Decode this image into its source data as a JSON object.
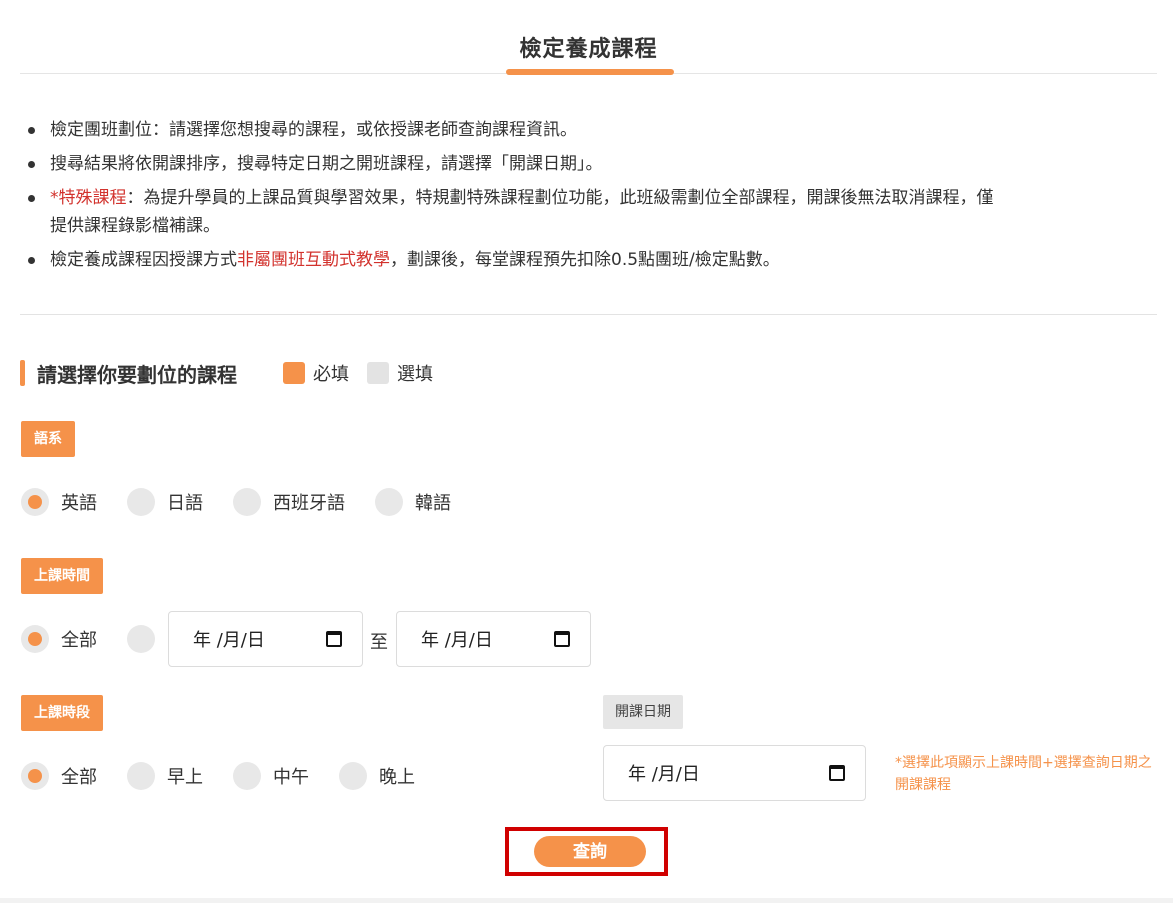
{
  "header": {
    "title": "檢定養成課程"
  },
  "notes": {
    "n1": "檢定團班劃位：請選擇您想搜尋的課程，或依授課老師查詢課程資訊。",
    "n2": "搜尋結果將依開課排序，搜尋特定日期之開班課程，請選擇「開課日期」。",
    "n3_red": "*特殊課程",
    "n3_rest": "：為提升學員的上課品質與學習效果，特規劃特殊課程劃位功能，此班級需劃位全部課程，開課後無法取消課程，僅提供課程錄影檔補課。",
    "n4_a": "檢定養成課程因授課方式",
    "n4_red": "非屬團班互動式教學",
    "n4_b": "，劃課後，每堂課程預先扣除0.5點團班/檢定點數。"
  },
  "section": {
    "title": "請選擇你要劃位的課程",
    "legend_required": "必填",
    "legend_optional": "選填"
  },
  "language": {
    "tag": "語系",
    "options": [
      "英語",
      "日語",
      "西班牙語",
      "韓語"
    ],
    "selected": "英語"
  },
  "class_time": {
    "tag": "上課時間",
    "all_label": "全部",
    "date_from": "年 /月/日",
    "to_label": "至",
    "date_to": "年 /月/日"
  },
  "class_period": {
    "tag": "上課時段",
    "options": [
      "全部",
      "早上",
      "中午",
      "晚上"
    ],
    "selected": "全部"
  },
  "open_date": {
    "tag": "開課日期",
    "date": "年 /月/日",
    "hint": "*選擇此項顯示上課時間+選擇查詢日期之開課課程"
  },
  "query_button": "查詢",
  "colors": {
    "accent": "#f5924a",
    "highlight_red": "#d00000",
    "note_red": "#d2322d"
  }
}
